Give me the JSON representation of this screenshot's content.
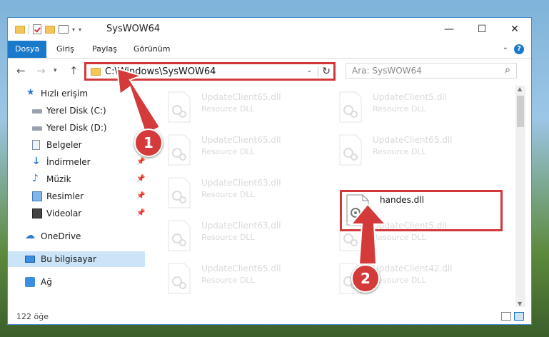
{
  "window": {
    "title": "SysWOW64",
    "controls": {
      "minimize": "—",
      "maximize": "☐",
      "close": "✕"
    }
  },
  "ribbon": {
    "tabs": [
      "Dosya",
      "Giriş",
      "Paylaş",
      "Görünüm"
    ],
    "active_tab": "Dosya",
    "active_color": "#1979ca"
  },
  "address_bar": {
    "path": "C:\\Windows\\SysWOW64"
  },
  "search": {
    "placeholder": "Ara: SysWOW64"
  },
  "sidebar": {
    "items": [
      {
        "label": "Hızlı erişim",
        "icon": "star-icon",
        "pinned": false
      },
      {
        "label": "Yerel Disk (C:)",
        "icon": "drive-icon",
        "pinned": false
      },
      {
        "label": "Yerel Disk (D:)",
        "icon": "drive-icon",
        "pinned": false
      },
      {
        "label": "Belgeler",
        "icon": "document-icon",
        "pinned": true
      },
      {
        "label": "İndirmeler",
        "icon": "download-icon",
        "pinned": true
      },
      {
        "label": "Müzik",
        "icon": "music-icon",
        "pinned": true
      },
      {
        "label": "Resimler",
        "icon": "pictures-icon",
        "pinned": true
      },
      {
        "label": "Videolar",
        "icon": "videos-icon",
        "pinned": true
      },
      {
        "label": "OneDrive",
        "icon": "cloud-icon",
        "pinned": false
      },
      {
        "label": "Bu bilgisayar",
        "icon": "computer-icon",
        "pinned": false,
        "selected": true
      },
      {
        "label": "Ağ",
        "icon": "network-icon",
        "pinned": false
      }
    ]
  },
  "files": [
    {
      "name": "UpdateClient65.dll",
      "type": "Resource DLL",
      "faded": true
    },
    {
      "name": "UpdateClient5.dll",
      "type": "Resource DLL",
      "faded": true
    },
    {
      "name": "UpdateClient65.dll",
      "type": "Resource DLL",
      "faded": true
    },
    {
      "name": "UpdateClient65.dll",
      "type": "Resource DLL",
      "faded": true
    },
    {
      "name": "UpdateClient63.dll",
      "type": "Resource DLL",
      "faded": true
    },
    {
      "name": "handes.dll",
      "type": "",
      "faded": false
    },
    {
      "name": "UpdateClient63.dll",
      "type": "Resource DLL",
      "faded": true
    },
    {
      "name": "UpdateClient5.dll",
      "type": "Resource DLL",
      "faded": true
    },
    {
      "name": "UpdateClient65.dll",
      "type": "Resource DLL",
      "faded": true
    },
    {
      "name": "UpdateClient42.dll",
      "type": "Resource DLL",
      "faded": true
    }
  ],
  "status_bar": {
    "item_count": "122 öğe"
  },
  "callouts": [
    {
      "number": "1"
    },
    {
      "number": "2"
    }
  ],
  "accent_colors": {
    "highlight_red": "#d2393b",
    "selection_blue": "#cce4f7"
  }
}
